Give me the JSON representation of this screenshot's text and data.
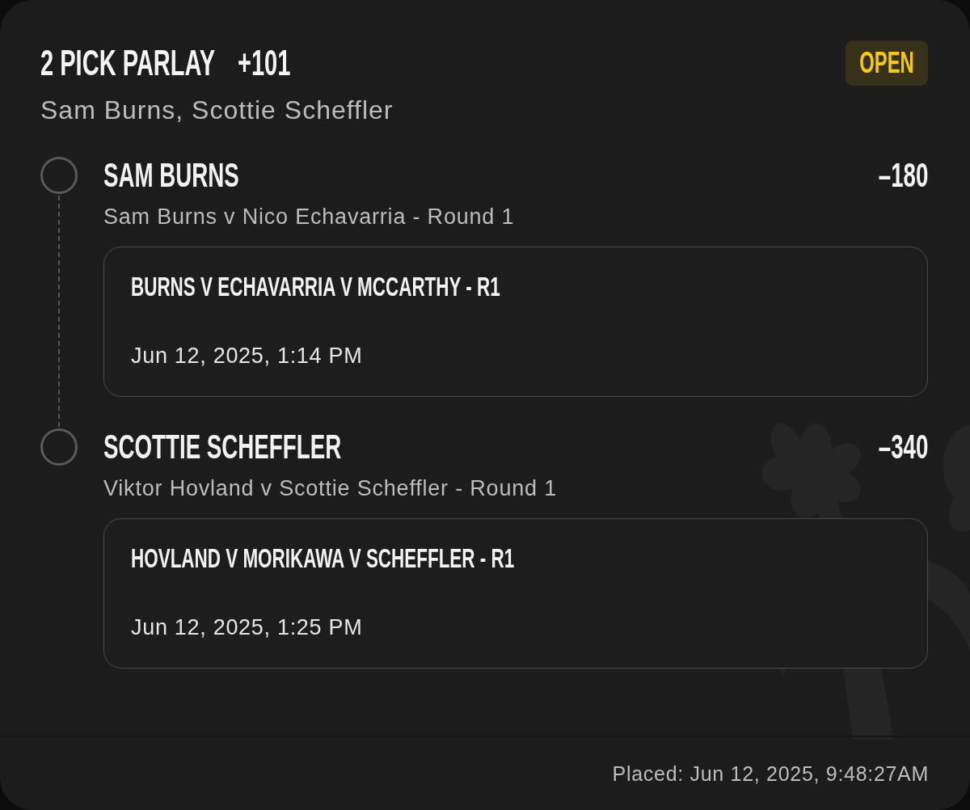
{
  "bet": {
    "title": "2 PICK PARLAY",
    "odds": "+101",
    "status": "OPEN",
    "picks_summary": "Sam Burns, Scottie Scheffler"
  },
  "legs": [
    {
      "selection": "SAM BURNS",
      "odds": "–180",
      "event": "Sam Burns v Nico Echavarria - Round 1",
      "market": "BURNS V ECHAVARRIA V MCCARTHY - R1",
      "start_time": "Jun 12, 2025, 1:14 PM"
    },
    {
      "selection": "SCOTTIE SCHEFFLER",
      "odds": "–340",
      "event": "Viktor Hovland v Scottie Scheffler - Round 1",
      "market": "HOVLAND V MORIKAWA V SCHEFFLER - R1",
      "start_time": "Jun 12, 2025, 1:25 PM"
    }
  ],
  "footer": {
    "placed": "Placed: Jun 12, 2025, 9:48:27AM"
  }
}
